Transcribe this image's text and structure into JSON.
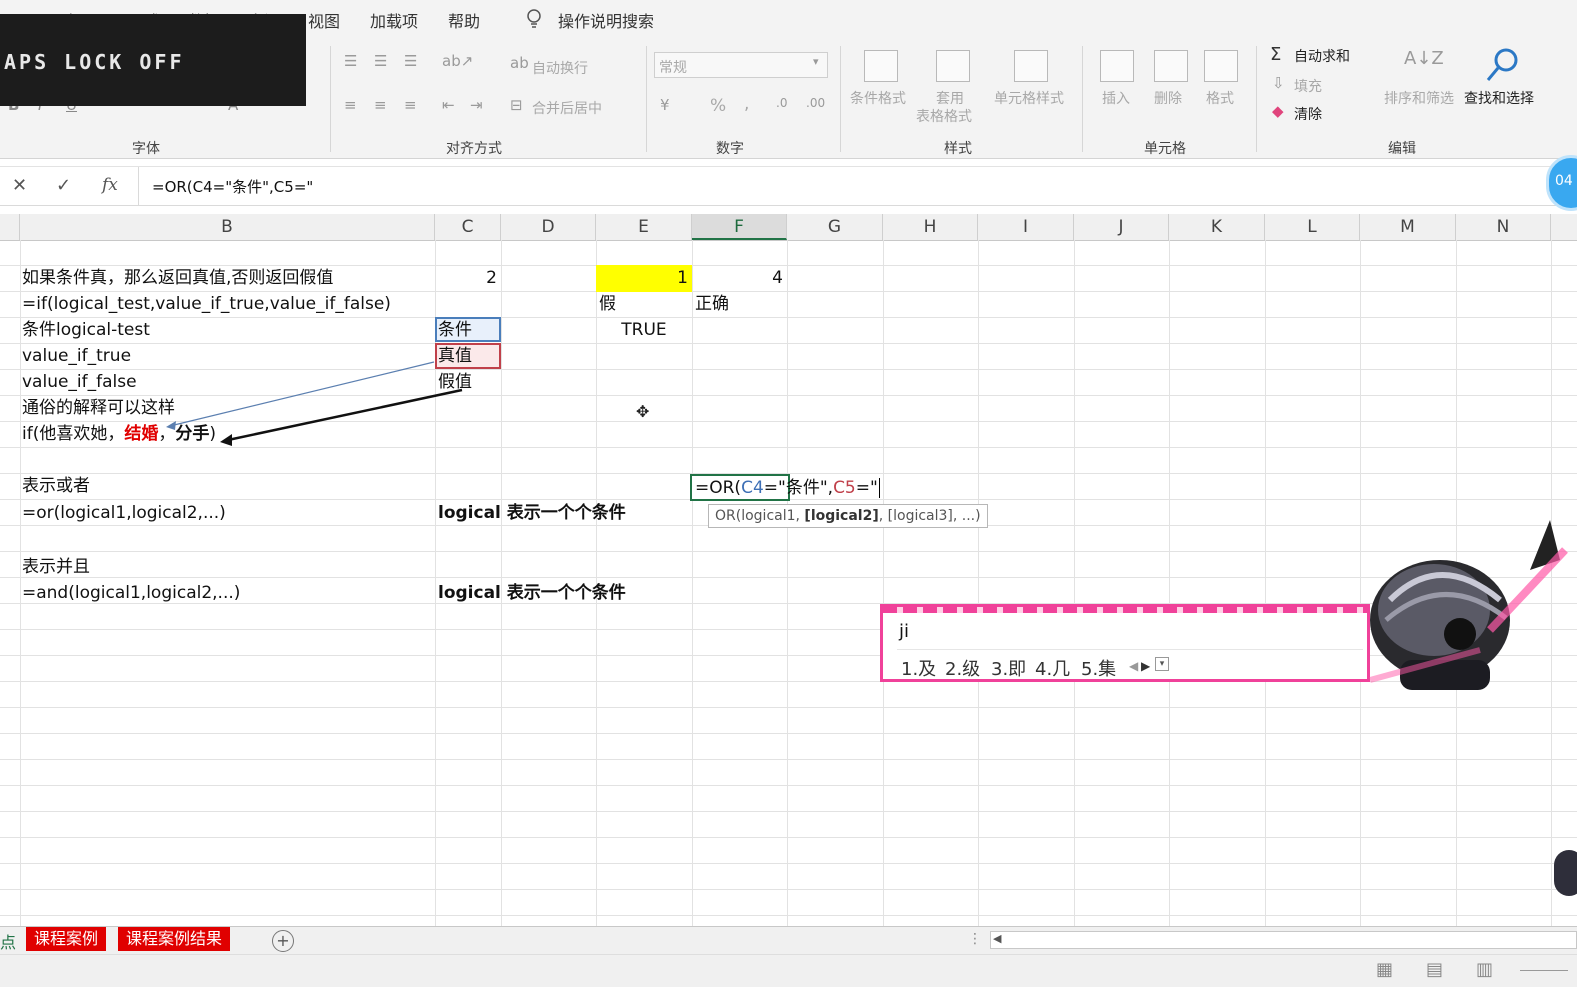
{
  "menu": {
    "items": [
      "页面布局",
      "公式",
      "数据",
      "审阅",
      "视图",
      "加载项",
      "帮助"
    ],
    "tell_me": "操作说明搜索"
  },
  "overlay": {
    "caps_text": "APS LOCK OFF"
  },
  "ribbon": {
    "groups": {
      "font": "字体",
      "alignment": "对齐方式",
      "number": "数字",
      "styles": "样式",
      "cells": "单元格",
      "editing": "编辑"
    },
    "wrap_text": "自动换行",
    "merge_center": "合并后居中",
    "number_format": "常规",
    "percent": "%",
    "comma": ",",
    "conditional_format": "条件格式",
    "format_table_1": "套用",
    "format_table_2": "表格格式",
    "cell_styles": "单元格样式",
    "insert": "插入",
    "delete": "删除",
    "format": "格式",
    "autosum": "自动求和",
    "fill": "填充",
    "clear": "清除",
    "sort_filter": "排序和筛选",
    "find_select": "查找和选择"
  },
  "formula_bar": {
    "fx_label": "fx",
    "formula": "=OR(C4=\"条件\",C5=\"",
    "side_badge": "04"
  },
  "columns": [
    "B",
    "C",
    "D",
    "E",
    "F",
    "G",
    "H",
    "I",
    "J",
    "K",
    "L",
    "M",
    "N"
  ],
  "cells": {
    "b3": "如果条件真，那么返回真值,否则返回假值",
    "c3": "2",
    "e3": "1",
    "f3": "4",
    "b4": "=if(logical_test,value_if_true,value_if_false)",
    "e4": "假",
    "f4": "正确",
    "b5": "条件logical-test",
    "c5": "条件",
    "e5": "TRUE",
    "b6": "value_if_true",
    "c6": "真值",
    "b7": "value_if_false",
    "c7": "假值",
    "b8": "通俗的解释可以这样",
    "b9_prefix": "if(他喜欢她，",
    "b9_red": "结婚",
    "b9_sep": "，",
    "b9_bold": "分手",
    "b9_suffix": ")",
    "b11": "表示或者",
    "b12": "=or(logical1,logical2,...)",
    "c12": "logical 表示一个个条件",
    "b14": "表示并且",
    "b15": "=and(logical1,logical2,...)",
    "c15": "logical 表示一个个条件"
  },
  "edit_cell": {
    "p1": "=OR(",
    "ref1": "C4",
    "p2": "=\"条件\",",
    "ref2": "C5",
    "p3": "=\""
  },
  "tooltip": {
    "name": "OR(logical1, ",
    "current": "[logical2]",
    "rest": ", [logical3], ...)"
  },
  "ime": {
    "input": "ji",
    "candidates": [
      "1.及",
      "2.级",
      "3.即",
      "4.几",
      "5.集"
    ]
  },
  "sheets": {
    "partial": "点",
    "tabs": [
      "课程案例",
      "课程案例结果"
    ],
    "add": "+"
  },
  "colors": {
    "yellow_fill": "#ffff00",
    "red_text": "#e00000",
    "tab_red": "#e00000",
    "ime_pink": "#f0419a"
  }
}
